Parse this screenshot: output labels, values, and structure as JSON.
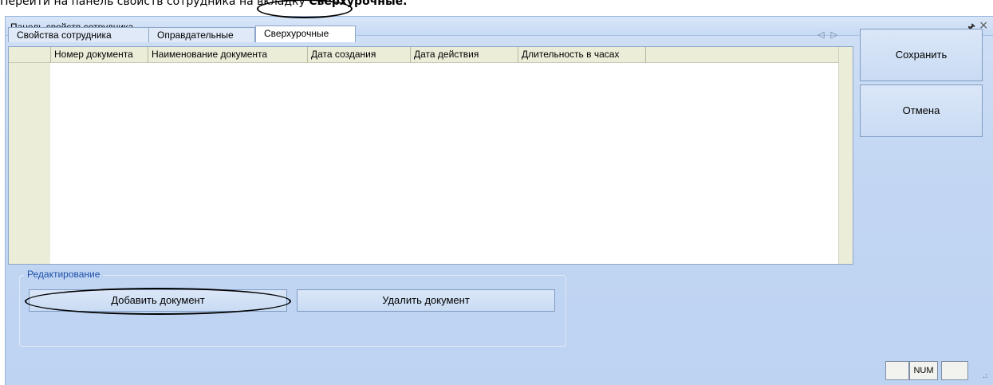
{
  "intro": {
    "text": "Перейти на панель свойств сотрудника на вкладку ",
    "bold": "Сверхурочные."
  },
  "panel": {
    "title": "Панель свойств сотрудника",
    "pin_icon": "pin-icon",
    "close_icon": "close-icon"
  },
  "tabs": [
    {
      "label": "Свойства сотрудника",
      "active": false
    },
    {
      "label": "Оправдательные",
      "active": false
    },
    {
      "label": "Сверхурочные",
      "active": true
    }
  ],
  "tab_nav": {
    "prev": "◁",
    "next": "▷"
  },
  "grid": {
    "columns": [
      "Номер документа",
      "Наименование документа",
      "Дата создания",
      "Дата действия",
      "Длительность в часах"
    ],
    "rows": []
  },
  "buttons": {
    "save": "Сохранить",
    "cancel": "Отмена"
  },
  "editing": {
    "group_label": "Редактирование",
    "add": "Добавить документ",
    "delete": "Удалить документ"
  },
  "statusbar": {
    "cell1": "",
    "cell2": "NUM",
    "cell3": ""
  },
  "colors": {
    "panel_bg": "#c3d7f3",
    "group_label": "#1e4fa8",
    "grid_header": "#ecedd9"
  }
}
